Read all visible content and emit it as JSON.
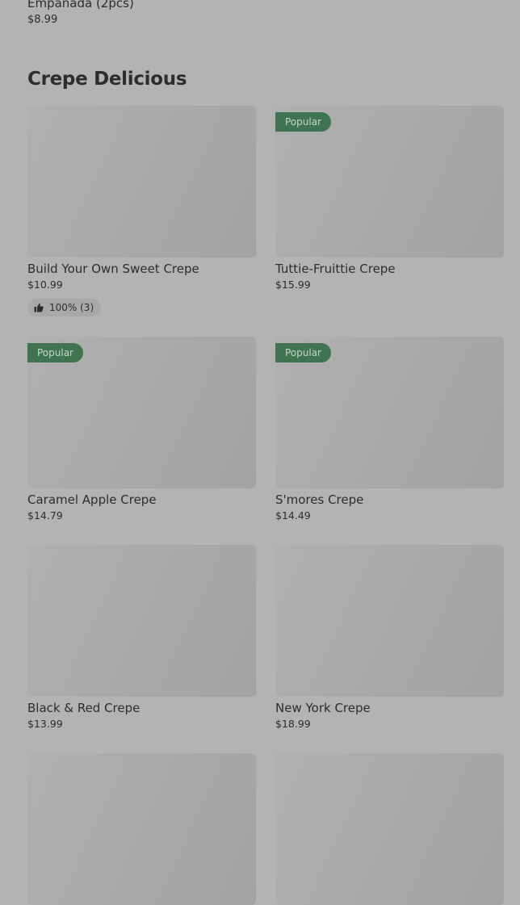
{
  "previous_item": {
    "name": "Empanada (2pcs)",
    "price": "$8.99"
  },
  "section": {
    "title": "Crepe Delicious"
  },
  "items": [
    {
      "name": "Build Your Own Sweet Crepe",
      "price": "$10.99",
      "popular": false,
      "rating": "100% (3)"
    },
    {
      "name": "Tuttie-Fruittie Crepe",
      "price": "$15.99",
      "popular": true,
      "badge": "Popular"
    },
    {
      "name": "Caramel Apple Crepe",
      "price": "$14.79",
      "popular": true,
      "badge": "Popular"
    },
    {
      "name": "S'mores Crepe",
      "price": "$14.49",
      "popular": true,
      "badge": "Popular"
    },
    {
      "name": "Black & Red Crepe",
      "price": "$13.99",
      "popular": false
    },
    {
      "name": "New York Crepe",
      "price": "$18.99",
      "popular": false
    },
    {
      "name": "",
      "price": "",
      "popular": false
    },
    {
      "name": "",
      "price": "",
      "popular": false
    }
  ],
  "icons": {
    "rating": "thumbs-up-icon"
  },
  "colors": {
    "overlay_background": "#b3b3b3",
    "badge_background": "#3f7450",
    "text": "#2d2d2d"
  }
}
